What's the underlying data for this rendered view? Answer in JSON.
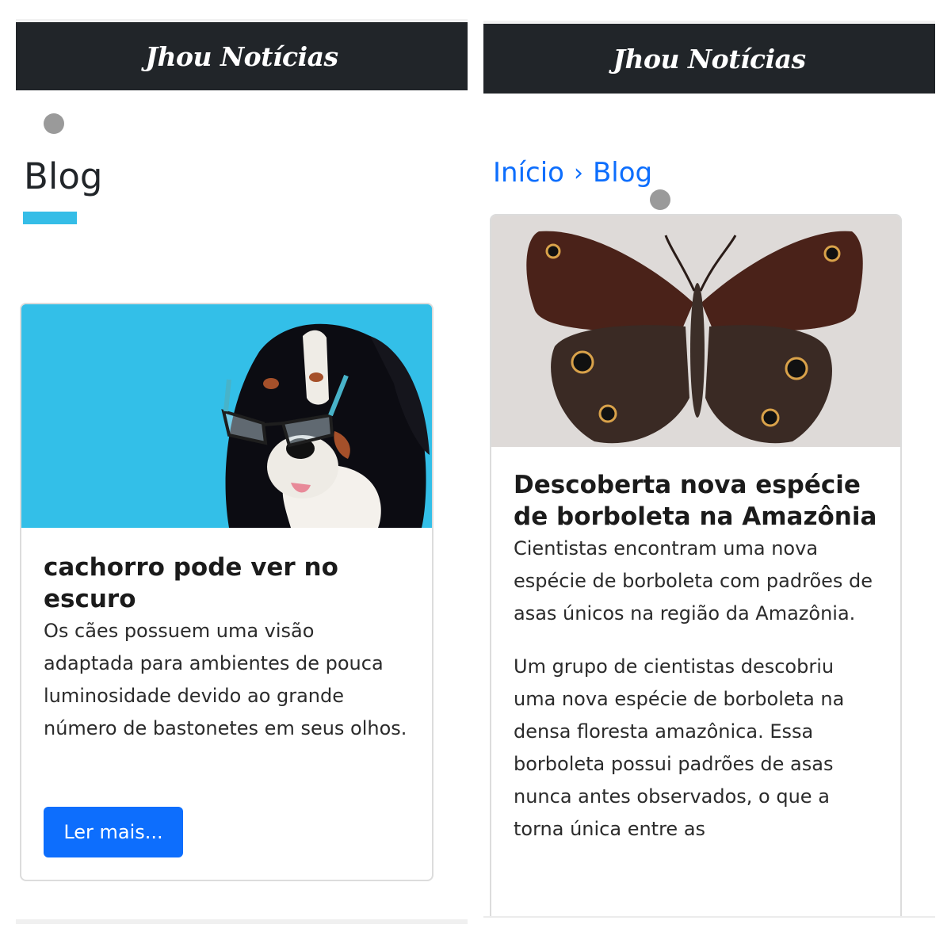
{
  "left_screen": {
    "navbar": {
      "brand": "Jhou Notícias"
    },
    "page_title": "Blog",
    "card": {
      "image_alt": "dog wearing sunglasses on blue background",
      "title": "cachorro pode ver no escuro",
      "text": "Os cães possuem uma visão adaptada para ambientes de pouca luminosidade devido ao grande número de bastonetes em seus olhos.",
      "button_label": "Ler mais..."
    }
  },
  "right_screen": {
    "navbar": {
      "brand": "Jhou Notícias"
    },
    "breadcrumb": {
      "home": "Início",
      "separator": "›",
      "current": "Blog"
    },
    "card": {
      "image_alt": "brown butterfly with eyespots",
      "title": "Descoberta nova espécie de borboleta na Amazônia",
      "summary": "Cientistas encontram uma nova espécie de borboleta com padrões de asas únicos na região da Amazônia.",
      "body": "Um grupo de cientistas descobriu uma nova espécie de borboleta na densa floresta amazônica. Essa borboleta possui padrões de asas nunca antes observados, o que a torna única entre as"
    }
  },
  "colors": {
    "navbar_bg": "#212529",
    "accent_bar": "#35bde7",
    "link": "#0d6efd",
    "button": "#0d6efd"
  }
}
